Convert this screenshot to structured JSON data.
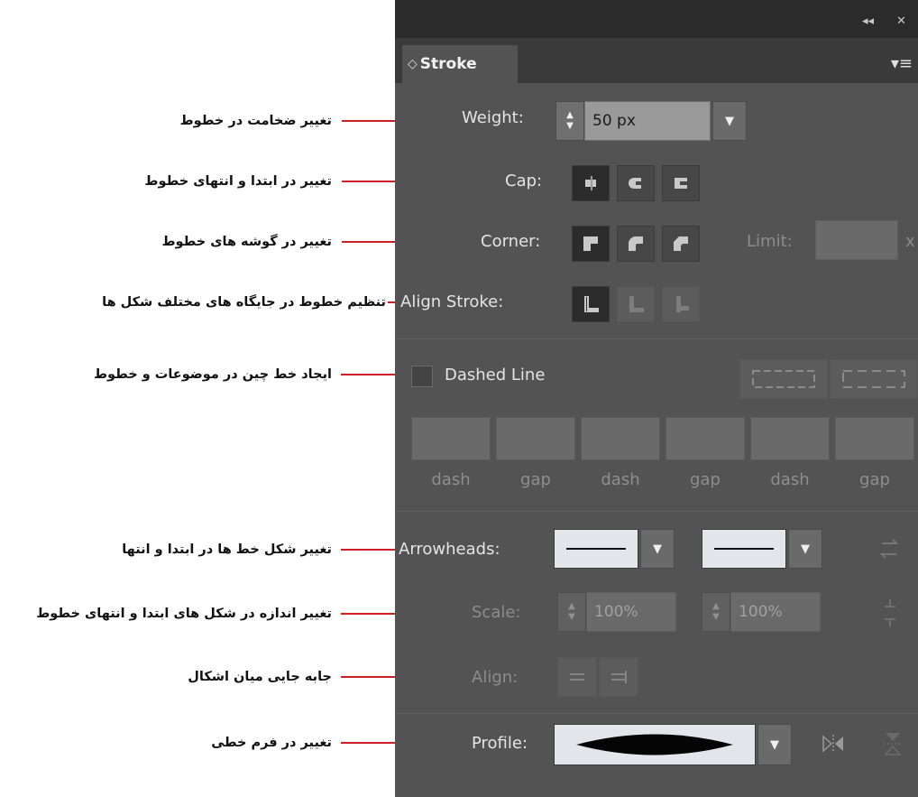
{
  "annotations": [
    {
      "text": "تغییر ضخامت در خطوط"
    },
    {
      "text": "تغییر در ابتدا و انتهای خطوط"
    },
    {
      "text": "تغییر در گوشه های خطوط"
    },
    {
      "text": "تنظیم خطوط در جایگاه های مختلف شکل ها"
    },
    {
      "text": "ایجاد خط چین در موضوعات و خطوط"
    },
    {
      "text": "تغییر شکل خط ها در ابتدا و انتها"
    },
    {
      "text": "تغییر اندازه در شکل های ابتدا و انتهای خطوط"
    },
    {
      "text": "جابه جایی میان اشکال"
    },
    {
      "text": "تغییر در فرم خطی"
    }
  ],
  "panel": {
    "title_controls": {
      "collapse": "◂◂",
      "close": "✕"
    },
    "tab": {
      "arrows": "◇",
      "label": "Stroke"
    },
    "menu_icon": "panel-menu-icon",
    "weight": {
      "label": "Weight:",
      "value": "50 px"
    },
    "cap": {
      "label": "Cap:"
    },
    "corner": {
      "label": "Corner:",
      "limit_label": "Limit:",
      "limit_value": "",
      "limit_unit": "x"
    },
    "align_stroke": {
      "label": "Align Stroke:"
    },
    "dashed": {
      "label": "Dashed Line",
      "checked": false
    },
    "dash_fields": [
      {
        "label": "dash"
      },
      {
        "label": "gap"
      },
      {
        "label": "dash"
      },
      {
        "label": "gap"
      },
      {
        "label": "dash"
      },
      {
        "label": "gap"
      }
    ],
    "arrowheads": {
      "label": "Arrowheads:"
    },
    "scale": {
      "label": "Scale:",
      "start": "100%",
      "end": "100%"
    },
    "align": {
      "label": "Align:"
    },
    "profile": {
      "label": "Profile:"
    }
  },
  "colors": {
    "panel_bg": "#535353",
    "annotation_line": "#cc1f26",
    "titlebar": "#2b2b2b"
  }
}
